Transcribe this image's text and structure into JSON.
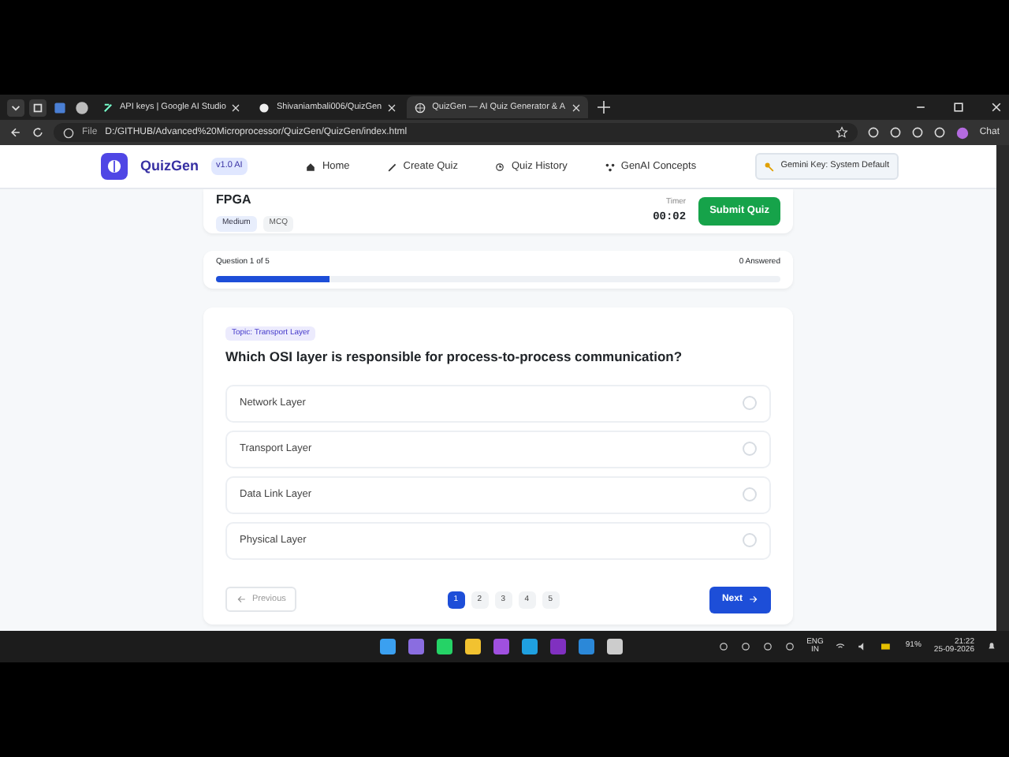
{
  "browser": {
    "tabs": [
      {
        "label": "API keys | Google AI Studio",
        "selected": false
      },
      {
        "label": "Shivaniambali006/QuizGen",
        "selected": false
      },
      {
        "label": "QuizGen — AI Quiz Generator & A",
        "selected": true
      }
    ],
    "scheme": "File",
    "address": "D:/GITHUB/Advanced%20Microprocessor/QuizGen/QuizGen/index.html",
    "chat": "Chat"
  },
  "app": {
    "brand": "QuizGen",
    "version": "v1.0 AI",
    "nav": [
      {
        "label": "Home",
        "kind": "home"
      },
      {
        "label": "Create Quiz",
        "kind": "wand"
      },
      {
        "label": "Quiz History",
        "kind": "history"
      },
      {
        "label": "GenAI Concepts",
        "kind": "network"
      }
    ],
    "key_button": "Gemini Key: System Default"
  },
  "quiz": {
    "title": "FPGA",
    "tags": [
      "Medium",
      "MCQ"
    ],
    "timer_label": "Timer",
    "timer": "00:02",
    "submit": "Submit Quiz"
  },
  "progress": {
    "label": "Question 1 of 5",
    "answered": "0 Answered",
    "level": 0.2
  },
  "question": {
    "topic": "Topic: Transport Layer",
    "text": "Which OSI layer is responsible for process-to-process communication?",
    "options": [
      {
        "label": "Network Layer",
        "selected": false
      },
      {
        "label": "Transport Layer",
        "selected": false
      },
      {
        "label": "Data Link Layer",
        "selected": false
      },
      {
        "label": "Physical Layer",
        "selected": false
      }
    ],
    "previous": {
      "label": "Previous",
      "disabled": true
    },
    "pages": [
      {
        "label": "1",
        "selected": true
      },
      {
        "label": "2",
        "selected": false
      },
      {
        "label": "3",
        "selected": false
      },
      {
        "label": "4",
        "selected": false
      },
      {
        "label": "5",
        "selected": false
      }
    ],
    "next": "Next"
  },
  "taskbar": {
    "language": "ENG",
    "region": "IN",
    "battery": "91%",
    "time": "21:22",
    "date": "25-09-2026"
  }
}
